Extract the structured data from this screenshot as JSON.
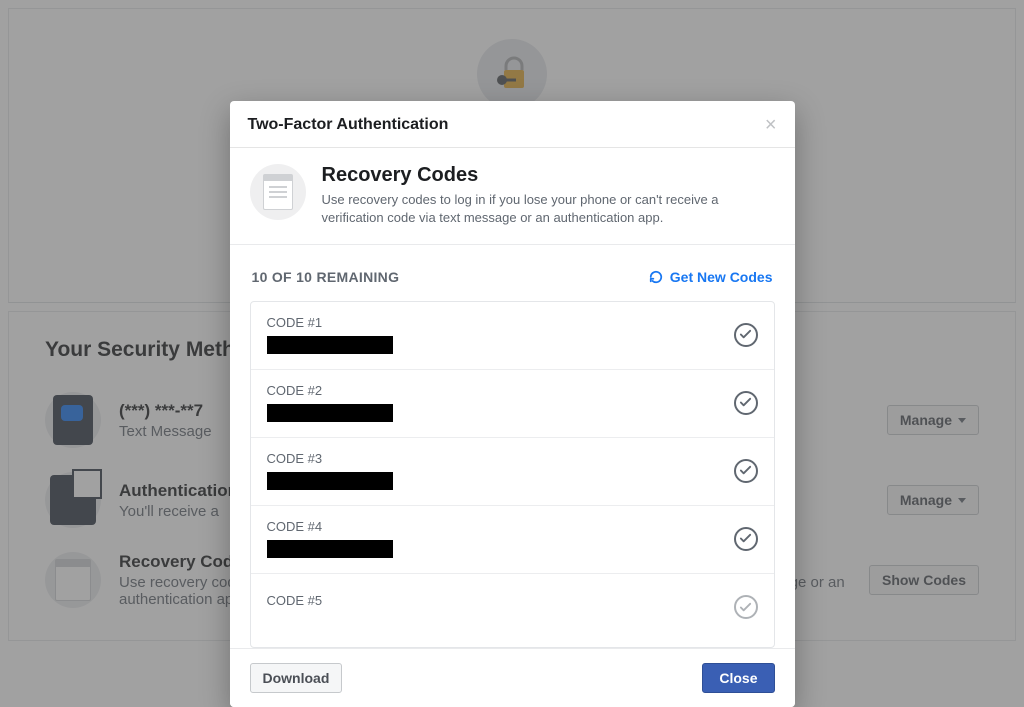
{
  "background": {
    "section_title": "Your Security Methods",
    "rows": [
      {
        "title": "(***) ***-**7",
        "sub": "Text Message",
        "button": "Manage"
      },
      {
        "title": "Authentication",
        "sub": "You'll receive a",
        "button": "Manage"
      },
      {
        "title": "Recovery Codes",
        "sub": "Use recovery codes to log in if you lose your phone or can't receive a verification code via text message or an authentication app.",
        "button": "Show Codes"
      }
    ]
  },
  "modal": {
    "title": "Two-Factor Authentication",
    "header": {
      "title": "Recovery Codes",
      "subtitle": "Use recovery codes to log in if you lose your phone or can't receive a verification code via text message or an authentication app."
    },
    "remaining_label": "10 OF 10 REMAINING",
    "get_new_codes_label": "Get New Codes",
    "codes": [
      {
        "label": "CODE #1"
      },
      {
        "label": "CODE #2"
      },
      {
        "label": "CODE #3"
      },
      {
        "label": "CODE #4"
      },
      {
        "label": "CODE #5"
      }
    ],
    "download_label": "Download",
    "close_label": "Close"
  }
}
